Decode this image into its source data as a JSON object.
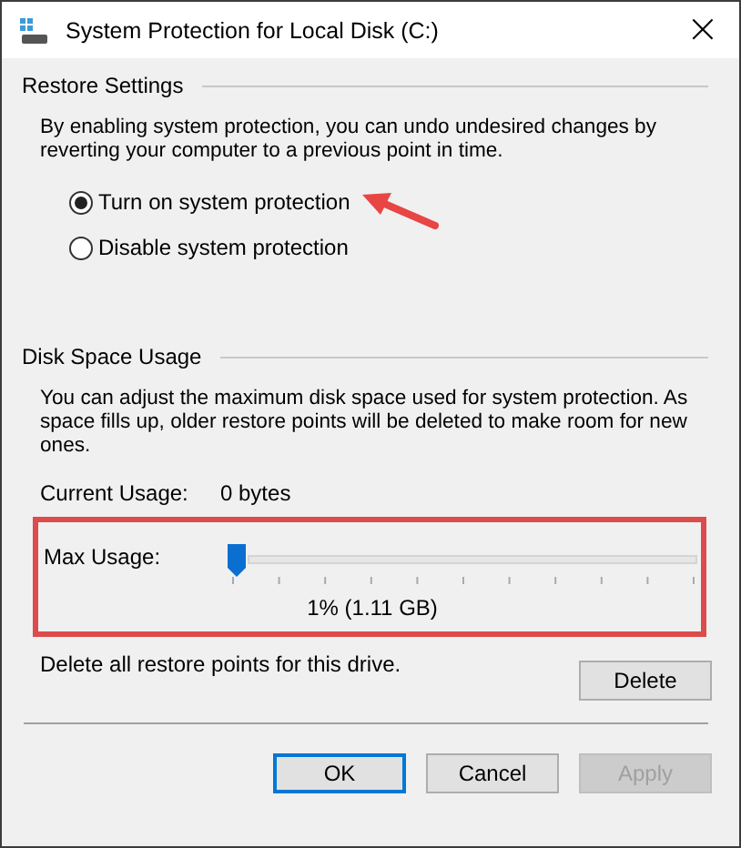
{
  "window": {
    "title": "System Protection for Local Disk (C:)",
    "close": "×"
  },
  "restore_settings": {
    "heading": "Restore Settings",
    "description": "By enabling system protection, you can undo undesired changes by reverting your computer to a previous point in time.",
    "options": [
      {
        "label": "Turn on system protection",
        "selected": true
      },
      {
        "label": "Disable system protection",
        "selected": false
      }
    ]
  },
  "disk_space_usage": {
    "heading": "Disk Space Usage",
    "description": "You can adjust the maximum disk space used for system protection. As space fills up, older restore points will be deleted to make room for new ones.",
    "current_usage_label": "Current Usage:",
    "current_usage_value": "0 bytes",
    "max_usage_label": "Max Usage:",
    "max_usage": {
      "level": 0.01
    },
    "max_usage_reading": "1% (1.11 GB)"
  },
  "delete_text": "Delete all restore points for this drive.",
  "delete_button": "Delete",
  "buttons": [
    {
      "label": "OK",
      "default": true,
      "disabled": false
    },
    {
      "label": "Cancel",
      "default": false,
      "disabled": false
    },
    {
      "label": "Apply",
      "default": false,
      "disabled": true
    }
  ]
}
